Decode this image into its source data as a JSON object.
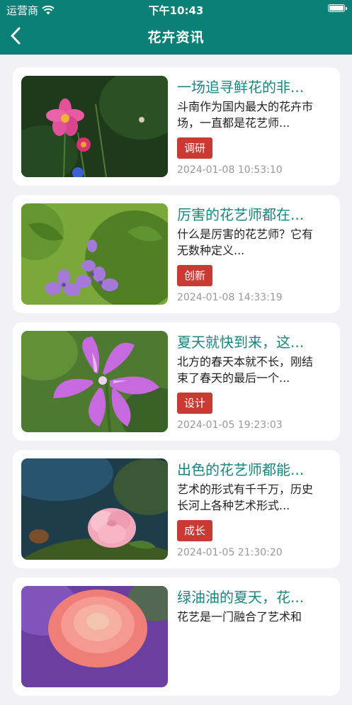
{
  "status_bar": {
    "carrier": "运营商",
    "time": "下午10:43",
    "icons": [
      "wifi-icon",
      "battery-icon"
    ]
  },
  "nav": {
    "title": "花卉资讯",
    "back_icon": "chevron-left-icon"
  },
  "colors": {
    "header": "#0a8077",
    "title_text": "#17877f",
    "tag_bg": "#c93a33",
    "page_bg": "#f2f2f4"
  },
  "articles": [
    {
      "title": "一场追寻鲜花的非...",
      "summary": "斗南作为国内最大的花卉市场，一直都是花艺师...",
      "tag": "调研",
      "date": "2024-01-08 10:53:10",
      "image": "pink-cosmos-flower"
    },
    {
      "title": "厉害的花艺师都在...",
      "summary": "什么是厉害的花艺师？它有无数种定义...",
      "tag": "创新",
      "date": "2024-01-08 14:33:19",
      "image": "purple-small-flowers"
    },
    {
      "title": "夏天就快到来，这...",
      "summary": "北方的春天本就不长，刚结束了春天的最后一个...",
      "tag": "设计",
      "date": "2024-01-05 19:23:03",
      "image": "pink-purple-vetch-flower"
    },
    {
      "title": "出色的花艺师都能...",
      "summary": "艺术的形式有千千万，历史长河上各种艺术形式...",
      "tag": "成长",
      "date": "2024-01-05 21:30:20",
      "image": "pink-rose"
    },
    {
      "title": "绿油油的夏天，花...",
      "summary": "花艺是一门融合了艺术和",
      "tag": "",
      "date": "",
      "image": "pink-dahlia"
    }
  ]
}
